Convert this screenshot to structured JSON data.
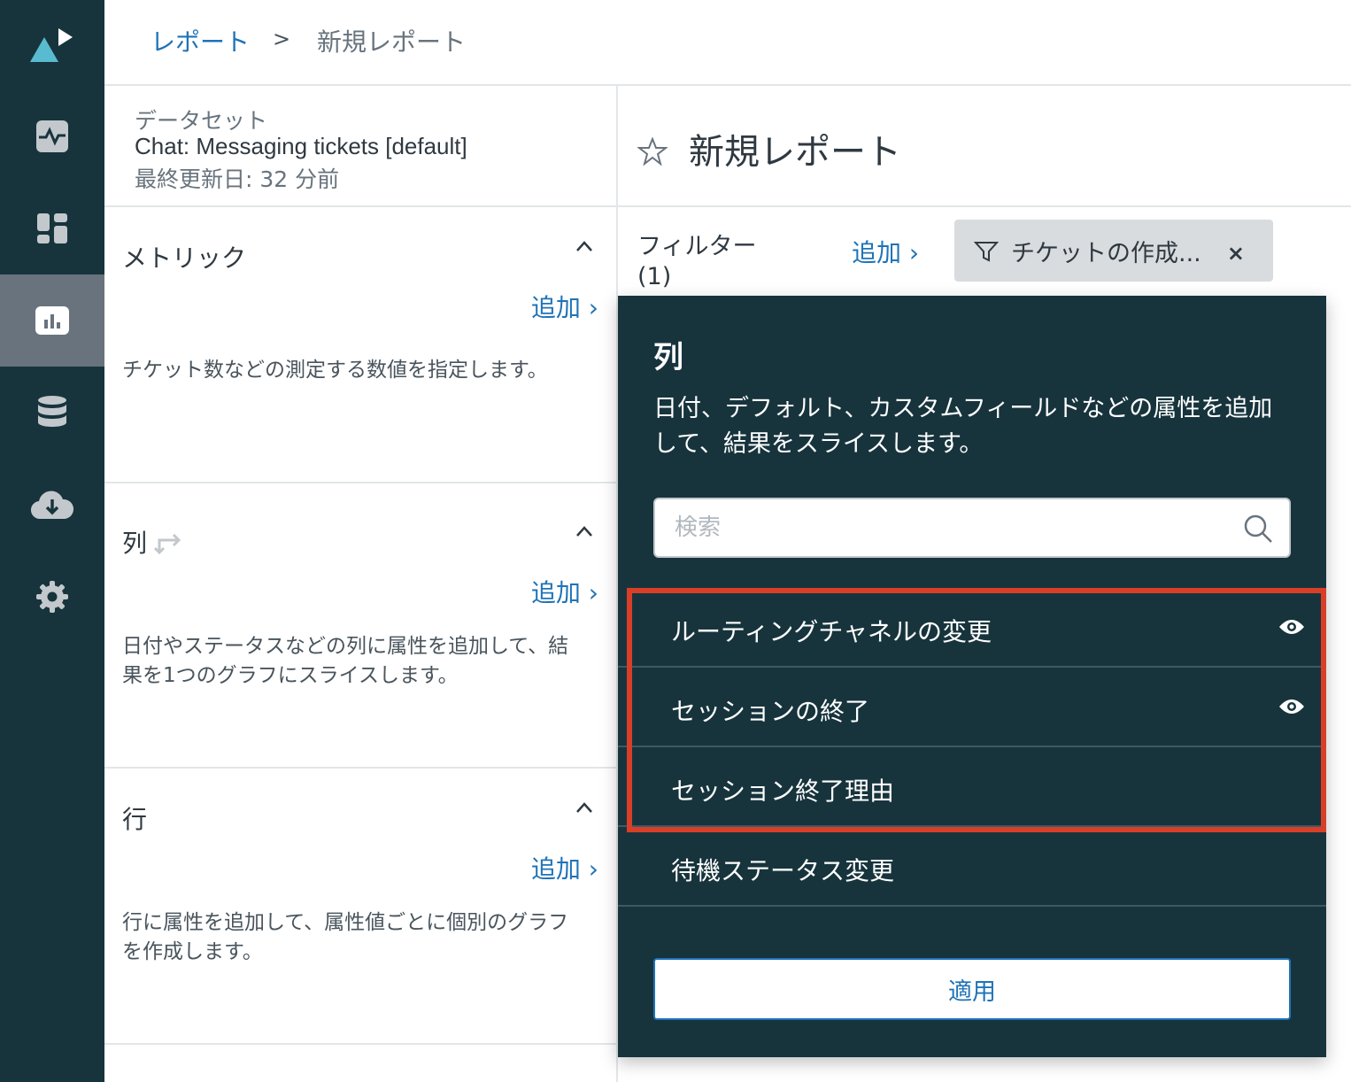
{
  "breadcrumb": {
    "parent": "レポート",
    "separator": ">",
    "current": "新規レポート"
  },
  "nav": {
    "items": [
      {
        "icon": "activity-icon",
        "active": false
      },
      {
        "icon": "dashboard-icon",
        "active": false
      },
      {
        "icon": "reports-icon",
        "active": true
      },
      {
        "icon": "database-icon",
        "active": false
      },
      {
        "icon": "cloud-download-icon",
        "active": false
      },
      {
        "icon": "gear-icon",
        "active": false
      }
    ]
  },
  "dataset": {
    "label": "データセット",
    "name": "Chat: Messaging tickets [default]",
    "updated": "最終更新日: 32 分前"
  },
  "sections": {
    "metrics": {
      "title": "メトリック",
      "add": "追加 ›",
      "desc": "チケット数などの測定する数値を指定します。"
    },
    "columns": {
      "title": "列",
      "add": "追加 ›",
      "desc": "日付やステータスなどの列に属性を追加して、結果を1つのグラフにスライスします。"
    },
    "rows": {
      "title": "行",
      "add": "追加 ›",
      "desc": "行に属性を追加して、属性値ごとに個別のグラフを作成します。"
    }
  },
  "report": {
    "title": "新規レポート"
  },
  "filters": {
    "label": "フィルター (1)",
    "add": "追加 ›",
    "chip_text": "チケットの作成...",
    "chip_close": "×"
  },
  "popover": {
    "title": "列",
    "desc": "日付、デフォルト、カスタムフィールドなどの属性を追加して、結果をスライスします。",
    "search_placeholder": "検索",
    "items": [
      {
        "label": "ルーティングチャネルの変更",
        "icon": "eye-icon"
      },
      {
        "label": "セッションの終了",
        "icon": "eye-icon"
      },
      {
        "label": "セッション終了理由",
        "icon": ""
      },
      {
        "label": "待機ステータス変更",
        "icon": ""
      }
    ],
    "apply": "適用"
  },
  "colors": {
    "rail": "#17343d",
    "rail_active": "#68737d",
    "link": "#1f73b7",
    "highlight": "#d93f27"
  }
}
